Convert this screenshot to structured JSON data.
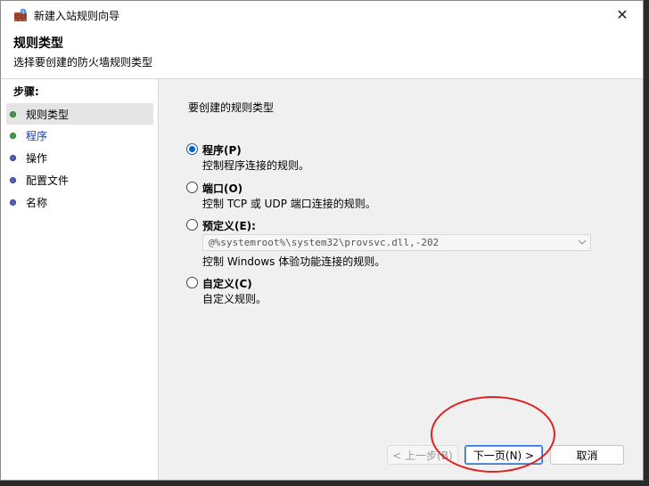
{
  "window": {
    "title": "新建入站规则向导",
    "close_glyph": "✕",
    "app_icon": "firewall-wall-icon"
  },
  "header": {
    "title": "规则类型",
    "subtitle": "选择要创建的防火墙规则类型"
  },
  "sidebar": {
    "heading": "步骤:",
    "items": [
      {
        "label": "规则类型",
        "dot": "green",
        "active": true
      },
      {
        "label": "程序",
        "dot": "green",
        "active": false
      },
      {
        "label": "操作",
        "dot": "blue",
        "active": false
      },
      {
        "label": "配置文件",
        "dot": "blue",
        "active": false
      },
      {
        "label": "名称",
        "dot": "blue",
        "active": false
      }
    ]
  },
  "main": {
    "question": "要创建的规则类型",
    "options": [
      {
        "label": "程序(P)",
        "description": "控制程序连接的规则。",
        "checked": true
      },
      {
        "label": "端口(O)",
        "description": "控制 TCP 或 UDP 端口连接的规则。",
        "checked": false
      },
      {
        "label": "预定义(E):",
        "description": "控制 Windows 体验功能连接的规则。",
        "checked": false
      },
      {
        "label": "自定义(C)",
        "description": "自定义规则。",
        "checked": false
      }
    ],
    "predefined_select_value": "@%systemroot%\\system32\\provsvc.dll,-202"
  },
  "buttons": {
    "back": "< 上一步(B)",
    "next": "下一页(N) >",
    "cancel": "取消"
  },
  "colors": {
    "accent": "#0a5fbf",
    "step_done": "#3ea043",
    "step_pending": "#5560b8",
    "annotation": "#e02020"
  }
}
